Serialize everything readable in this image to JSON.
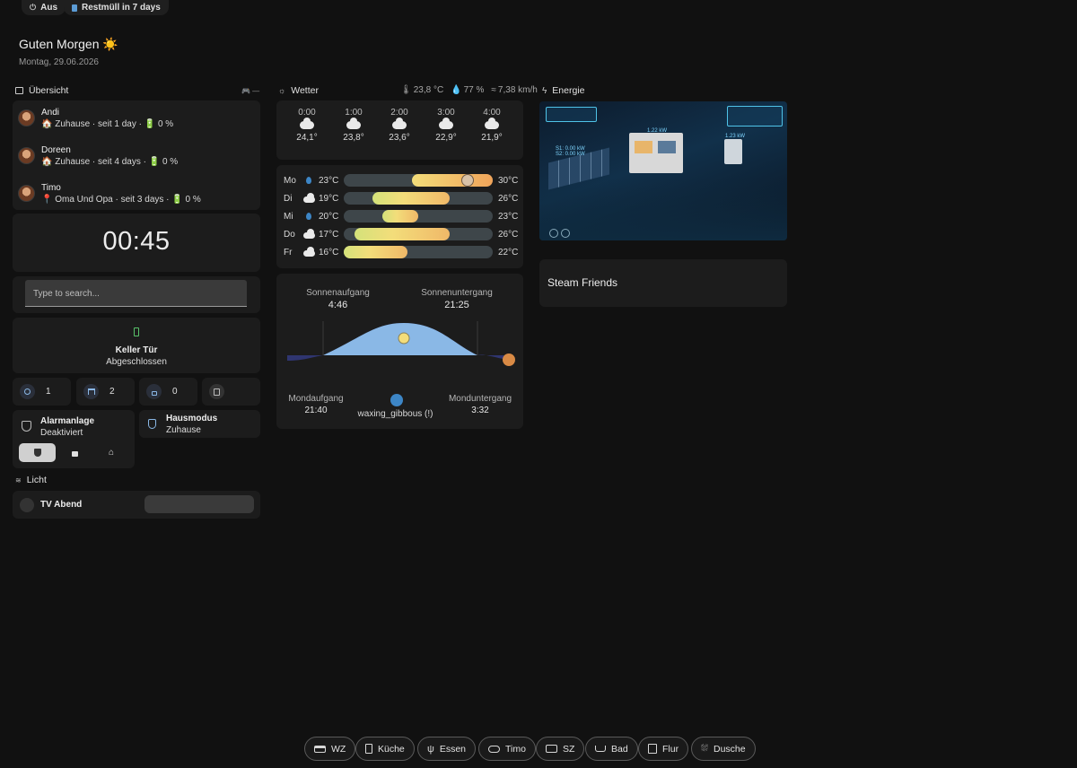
{
  "top_chips": [
    {
      "icon": "power-icon",
      "label": "Aus"
    },
    {
      "icon": "trash-bin-icon",
      "label": "Restmüll in 7 days"
    }
  ],
  "greeting": "Guten Morgen ☀️",
  "date": "Montag, 29.06.2026",
  "overview": {
    "title": "Übersicht",
    "persons": [
      {
        "name": "Andi",
        "status": "🏠 Zuhause · seit 1 day · 🔋 0 %"
      },
      {
        "name": "Doreen",
        "status": "🏠 Zuhause · seit 4 days · 🔋 0 %"
      },
      {
        "name": "Timo",
        "status": "📍 Oma Und Opa · seit 3 days · 🔋 0 %"
      }
    ],
    "clock": "00:45",
    "search_placeholder": "Type to search...",
    "door": {
      "name": "Keller Tür",
      "state": "Abgeschlossen"
    },
    "counters": [
      {
        "icon": "lightbulb-icon",
        "value": "1"
      },
      {
        "icon": "shutter-icon",
        "value": "2"
      },
      {
        "icon": "lock-icon",
        "value": "0"
      },
      {
        "icon": "device-icon",
        "value": ""
      }
    ],
    "alarm": {
      "title": "Alarmanlage",
      "state": "Deaktiviert"
    },
    "housemode": {
      "title": "Hausmodus",
      "state": "Zuhause"
    },
    "light_section": "Licht",
    "scene": {
      "name": "TV Abend"
    }
  },
  "weather": {
    "title": "Wetter",
    "current": {
      "temp": "23,8 °C",
      "humidity": "77 %",
      "wind": "7,38 km/h"
    },
    "hourly": [
      {
        "time": "0:00",
        "temp": "24,1°"
      },
      {
        "time": "1:00",
        "temp": "23,8°"
      },
      {
        "time": "2:00",
        "temp": "23,6°"
      },
      {
        "time": "3:00",
        "temp": "22,9°"
      },
      {
        "time": "4:00",
        "temp": "21,9°"
      }
    ],
    "forecast": [
      {
        "day": "Mo",
        "icon": "rain",
        "min": "23°C",
        "max": "30°C",
        "fill_start": 0.46,
        "fill_end": 1.0,
        "current": 0.83
      },
      {
        "day": "Di",
        "icon": "cloud",
        "min": "19°C",
        "max": "26°C",
        "fill_start": 0.19,
        "fill_end": 0.71
      },
      {
        "day": "Mi",
        "icon": "rain",
        "min": "20°C",
        "max": "23°C",
        "fill_start": 0.26,
        "fill_end": 0.5
      },
      {
        "day": "Do",
        "icon": "cloud",
        "min": "17°C",
        "max": "26°C",
        "fill_start": 0.07,
        "fill_end": 0.71
      },
      {
        "day": "Fr",
        "icon": "cloud",
        "min": "16°C",
        "max": "22°C",
        "fill_start": 0.0,
        "fill_end": 0.43
      }
    ],
    "sun": {
      "rise_label": "Sonnenaufgang",
      "rise": "4:46",
      "set_label": "Sonnenuntergang",
      "set": "21:25"
    },
    "moon": {
      "rise_label": "Mondaufgang",
      "rise": "21:40",
      "set_label": "Monduntergang",
      "set": "3:32",
      "phase": "waxing_gibbous (!)"
    }
  },
  "energy": {
    "title": "Energie",
    "image_labels": {
      "house_power": "1.22 kW",
      "plug_power": "1.23 kW",
      "solar": "S1: 0.00 kW\nS2: 0.00 kW"
    },
    "steam_title": "Steam Friends"
  },
  "nav": [
    "WZ",
    "Küche",
    "Essen",
    "Timo",
    "SZ",
    "Bad",
    "Flur",
    "Dusche"
  ],
  "colors": {
    "accent_blue": "#8ab8e6",
    "warm": "#f0a45a",
    "yellow": "#f3dd7a"
  }
}
